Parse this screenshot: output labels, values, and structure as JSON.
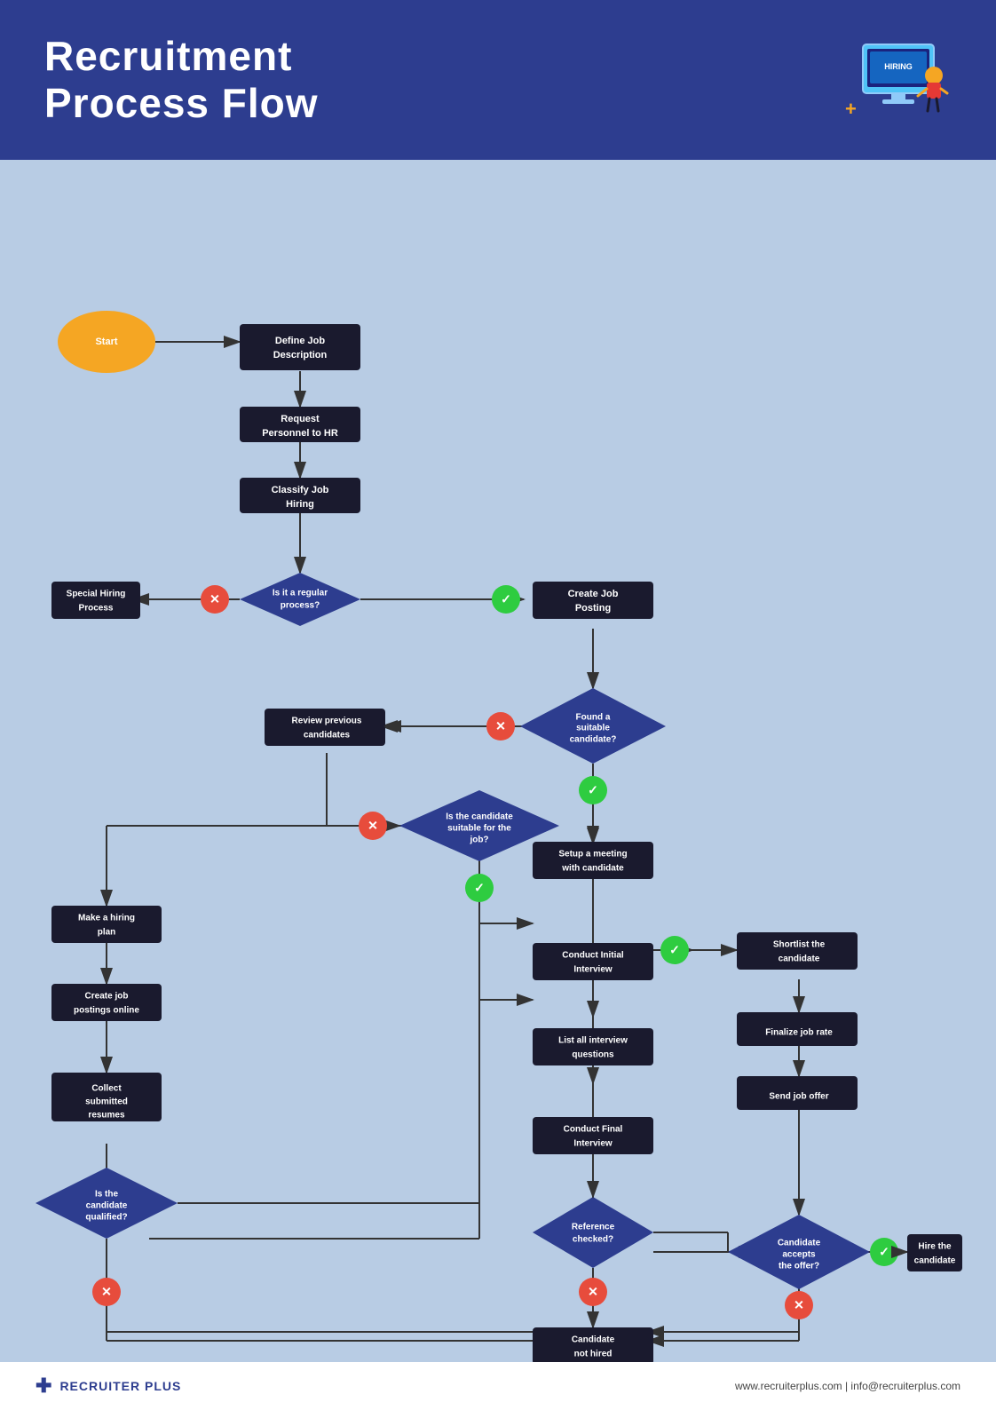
{
  "header": {
    "title_line1": "Recruitment",
    "title_line2": "Process Flow"
  },
  "footer": {
    "logo_text": "RECRUITER PLUS",
    "contact": "www.recruiterplus.com | info@recruiterplus.com"
  },
  "nodes": {
    "start": "Start",
    "define_job": "Define Job\nDescription",
    "request_personnel": "Request\nPersonnel to HR",
    "classify_job": "Classify Job\nHiring",
    "is_regular": "Is it a regular\nprocess?",
    "special_hiring": "Special Hiring\nProcess",
    "create_job_posting": "Create Job\nPosting",
    "found_candidate": "Found a\nsuitable\ncandidate?",
    "review_previous": "Review previous\ncandidates",
    "is_candidate_suitable": "Is the candidate\nsuitable for the\njob?",
    "make_hiring_plan": "Make a hiring\nplan",
    "create_job_postings_online": "Create job\npostings online",
    "collect_resumes": "Collect\nsubmitted\nresumes",
    "is_qualified": "Is the\ncandidate\nqualified?",
    "setup_meeting": "Setup a meeting\nwith candidate",
    "shortlist": "Shortlist the\ncandidate",
    "conduct_initial": "Conduct Initial\nInterview",
    "finalize_job_rate": "Finalize job rate",
    "list_questions": "List all interview\nquestions",
    "send_job_offer": "Send job offer",
    "conduct_final": "Conduct Final\nInterview",
    "reference_checked": "Reference\nchecked?",
    "candidate_accepts": "Candidate\naccepts\nthe offer?",
    "candidate_not_hired": "Candidate\nnot hired",
    "hire_candidate": "Hire the\ncandidate"
  }
}
